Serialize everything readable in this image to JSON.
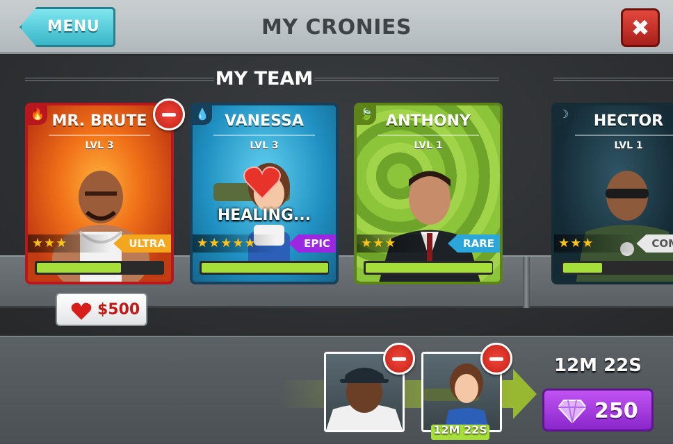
{
  "header": {
    "menu_label": "MENU",
    "title": "MY CRONIES",
    "close_symbol": "✖"
  },
  "team": {
    "heading": "MY TEAM",
    "cards": [
      {
        "name": "MR. BRUTE",
        "level": "LVL 3",
        "element_icon": "fire-icon",
        "stars": 3,
        "rarity": "ULTRA",
        "rarity_color": "#f4a61e",
        "health": 0.7
      },
      {
        "name": "VANESSA",
        "level": "LVL 3",
        "element_icon": "water-drop-icon",
        "stars": 5,
        "rarity": "EPIC",
        "rarity_color": "#9b27e0",
        "health": 1.0,
        "status": "HEALING..."
      },
      {
        "name": "ANTHONY",
        "level": "LVL 1",
        "element_icon": "leaf-icon",
        "stars": 3,
        "rarity": "RARE",
        "rarity_color": "#2aa6d9",
        "health": 1.0
      },
      {
        "name": "HECTOR",
        "level": "LVL 1",
        "element_icon": "moon-icon",
        "stars": 3,
        "rarity": "COMM",
        "rarity_color": "#e8e8e8",
        "health": 0.5
      }
    ],
    "heal_cost": "$500"
  },
  "queue": {
    "slot_timer": "12M 22S",
    "timer": "12M 22S",
    "gem_cost": "250"
  },
  "colors": {
    "health_bar": "#a6df3a",
    "remove_button": "#e23a2f",
    "gem_button": "#a43de6"
  }
}
